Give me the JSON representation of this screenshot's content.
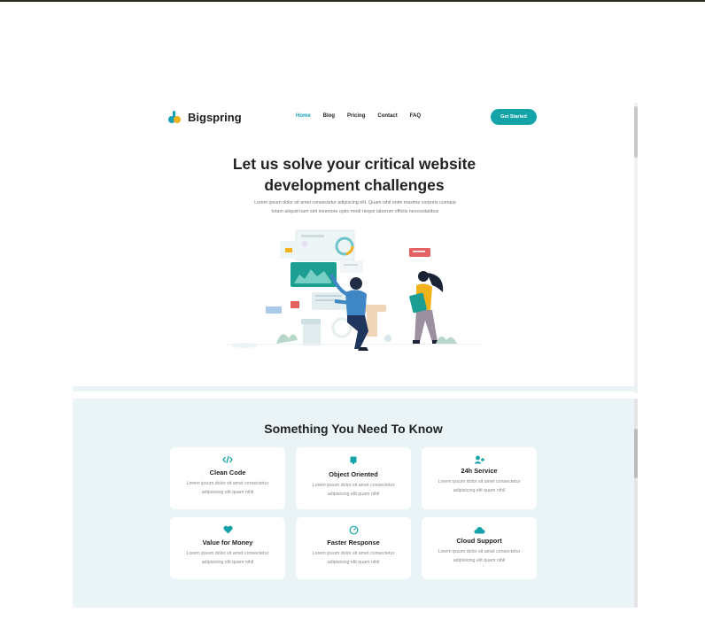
{
  "brand": {
    "name": "Bigspring"
  },
  "nav": {
    "items": [
      "Home",
      "Blog",
      "Pricing",
      "Contact",
      "FAQ"
    ],
    "active": "Home"
  },
  "cta": {
    "label": "Get Started"
  },
  "hero": {
    "title_line1": "Let us solve your critical website",
    "title_line2": "development challenges",
    "subtitle_line1": "Lorem ipsum dolor sit amet consectetur adipiscing elit. Quam nihil enim maxime corporis cumque",
    "subtitle_line2": "totam aliquid nam sint inventore optio modi neque laborum officiis necessitatibus"
  },
  "features": {
    "title": "Something You Need To Know",
    "cards": [
      {
        "icon": "code-icon",
        "title": "Clean Code",
        "desc1": "Lorem ipsum dolor sit amet consectetur",
        "desc2": "adipisicing elit quam nihil"
      },
      {
        "icon": "cube-icon",
        "title": "Object Oriented",
        "desc1": "Lorem ipsum dolor sit amet consectetur",
        "desc2": "adipisicing elit quam nihil"
      },
      {
        "icon": "user-plus-icon",
        "title": "24h Service",
        "desc1": "Lorem ipsum dolor sit amet consectetur",
        "desc2": "adipisicing elit quam nihil"
      },
      {
        "icon": "heart-icon",
        "title": "Value for Money",
        "desc1": "Lorem ipsum dolor sit amet consectetur",
        "desc2": "adipisicing elit quam nihil"
      },
      {
        "icon": "gauge-icon",
        "title": "Faster Response",
        "desc1": "Lorem ipsum dolor sit amet consectetur",
        "desc2": "adipisicing elit quam nihil"
      },
      {
        "icon": "cloud-icon",
        "title": "Cloud Support",
        "desc1": "Lorem ipsum dolor sit amet consectetur",
        "desc2": "adipisicing elit quam nihil"
      }
    ]
  },
  "colors": {
    "accent": "#14a3a8",
    "section_bg": "#eaf4f6"
  }
}
